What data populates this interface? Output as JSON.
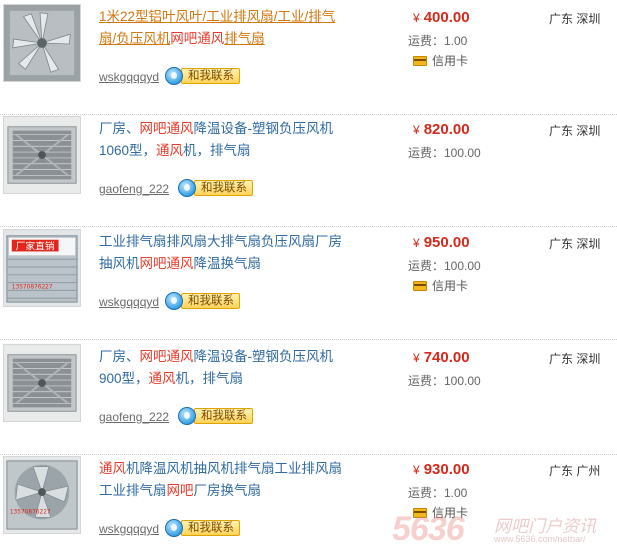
{
  "listings": [
    {
      "title": [
        {
          "text": "1米22型铝叶风叶/工业排风扇/工业/排气扇/负压风机",
          "style": "orange"
        },
        {
          "text": "网吧通风",
          "style": "red"
        },
        {
          "text": "排气扇",
          "style": "orange"
        }
      ],
      "seller": "wskgqqqyd",
      "contact_label": "和我联系",
      "price_symbol": "¥",
      "price": "400.00",
      "freight": "运费：1.00",
      "credit_card": "信用卡",
      "location": "广东 深圳",
      "thumb": "aluminum-blade-fan"
    },
    {
      "title": [
        {
          "text": "厂房、",
          "style": "normal"
        },
        {
          "text": "网吧通风",
          "style": "red"
        },
        {
          "text": "降温设备-塑钢负压风机 1060型，",
          "style": "normal"
        },
        {
          "text": "通风",
          "style": "red"
        },
        {
          "text": "机，排气扇",
          "style": "normal"
        }
      ],
      "seller": "gaofeng_222",
      "contact_label": "和我联系",
      "price_symbol": "¥",
      "price": "820.00",
      "freight": "运费：100.00",
      "credit_card": "",
      "location": "广东 深圳",
      "thumb": "box-fan-grille"
    },
    {
      "title": [
        {
          "text": "工业排气扇排风扇大排气扇负压风扇厂房抽风机",
          "style": "normal"
        },
        {
          "text": "网吧通风",
          "style": "red"
        },
        {
          "text": "降温换气扇",
          "style": "normal"
        }
      ],
      "seller": "wskgqqqyd",
      "contact_label": "和我联系",
      "price_symbol": "¥",
      "price": "950.00",
      "freight": "运费：100.00",
      "credit_card": "信用卡",
      "location": "广东 深圳",
      "thumb": "box-fan-shutter-red"
    },
    {
      "title": [
        {
          "text": "厂房、",
          "style": "normal"
        },
        {
          "text": "网吧通风",
          "style": "red"
        },
        {
          "text": "降温设备-塑钢负压风机 900型，",
          "style": "normal"
        },
        {
          "text": "通风",
          "style": "red"
        },
        {
          "text": "机，排气扇",
          "style": "normal"
        }
      ],
      "seller": "gaofeng_222",
      "contact_label": "和我联系",
      "price_symbol": "¥",
      "price": "740.00",
      "freight": "运费：100.00",
      "credit_card": "",
      "location": "广东 深圳",
      "thumb": "box-fan-grille"
    },
    {
      "title": [
        {
          "text": "通风",
          "style": "red"
        },
        {
          "text": "机降温风机抽风机排气扇工业排风扇工业排气扇",
          "style": "normal"
        },
        {
          "text": "网吧",
          "style": "red"
        },
        {
          "text": "厂房换气扇",
          "style": "normal"
        }
      ],
      "seller": "wskgqqqyd",
      "contact_label": "和我联系",
      "price_symbol": "¥",
      "price": "930.00",
      "freight": "运费：1.00",
      "credit_card": "信用卡",
      "location": "广东 广州",
      "thumb": "box-fan-shutter"
    }
  ],
  "watermark": {
    "number": "5636",
    "text": "网吧门户资讯",
    "url": "www.5636.com/netbar/"
  },
  "colors": {
    "link": "#2f6aa0",
    "highlight": "#e83a2a",
    "price": "#d4291b"
  }
}
